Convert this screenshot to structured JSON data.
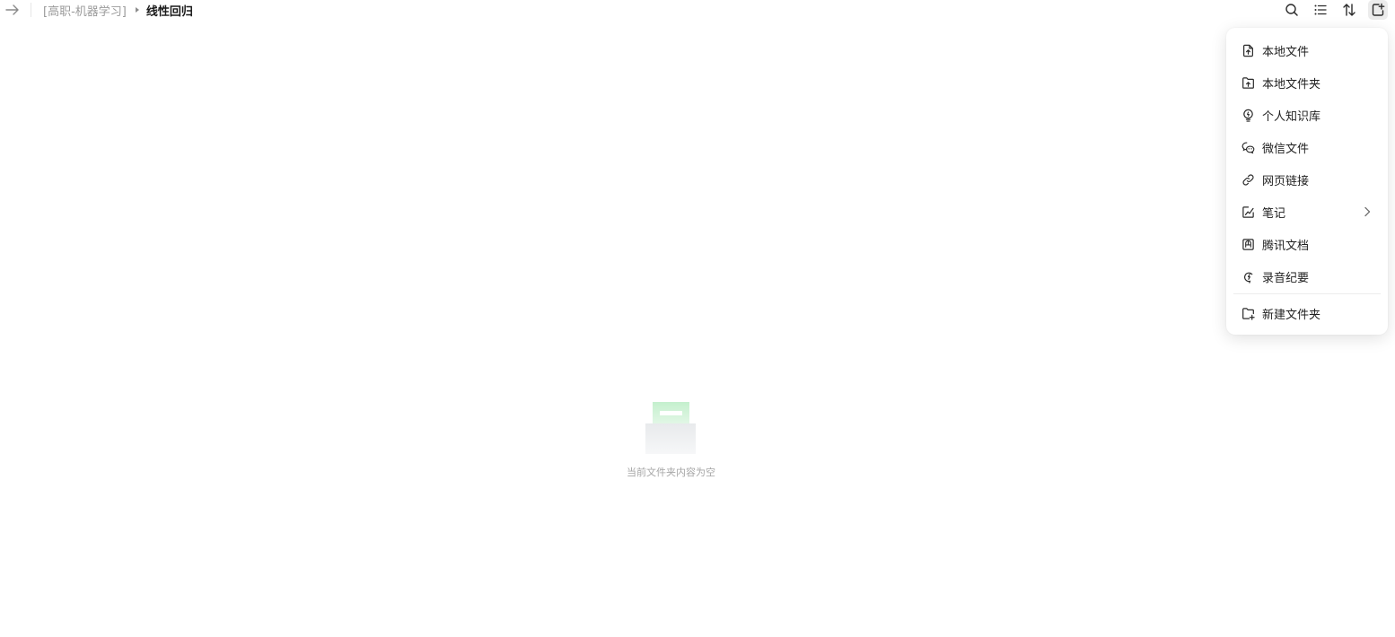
{
  "breadcrumb": {
    "parent": "[高职-机器学习]",
    "current": "线性回归"
  },
  "toolbar": {
    "icons": [
      "search-icon",
      "list-view-icon",
      "sort-icon",
      "new-file-icon"
    ]
  },
  "menu": {
    "items": [
      {
        "label": "本地文件",
        "icon": "upload-file-icon"
      },
      {
        "label": "本地文件夹",
        "icon": "upload-folder-icon"
      },
      {
        "label": "个人知识库",
        "icon": "bulb-icon"
      },
      {
        "label": "微信文件",
        "icon": "wechat-icon"
      },
      {
        "label": "网页链接",
        "icon": "link-icon"
      },
      {
        "label": "笔记",
        "icon": "note-icon",
        "has_submenu": true
      },
      {
        "label": "腾讯文档",
        "icon": "tencent-docs-icon"
      },
      {
        "label": "录音纪要",
        "icon": "recording-icon"
      }
    ],
    "new_folder": {
      "label": "新建文件夹",
      "icon": "new-folder-icon"
    }
  },
  "empty_state": {
    "message": "当前文件夹内容为空",
    "accent_color": "#c9f2d2"
  }
}
